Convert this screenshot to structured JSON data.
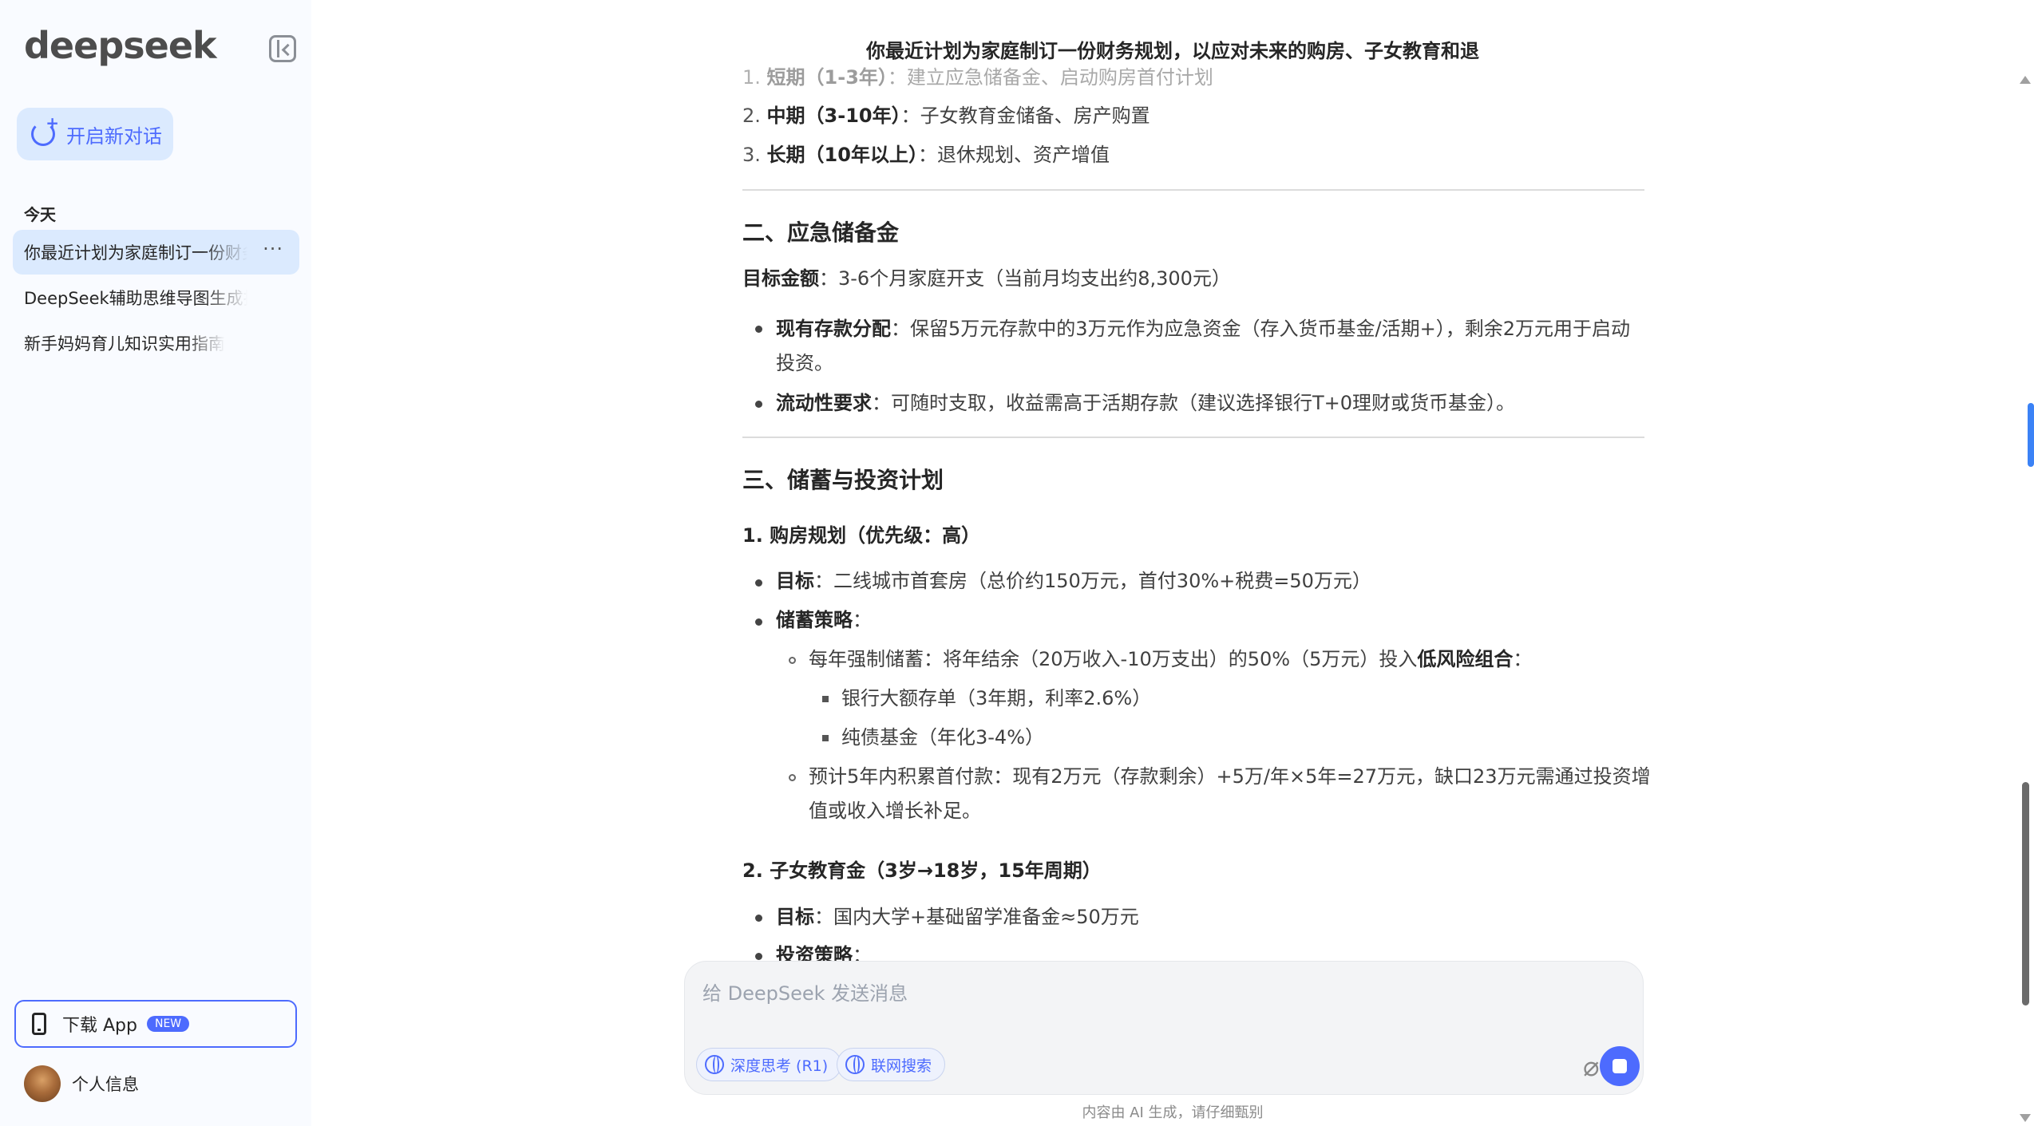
{
  "sidebar": {
    "logo": "deepseek",
    "new_chat_label": "开启新对话",
    "section_today": "今天",
    "conversations": [
      {
        "title": "你最近计划为家庭制订一份财务规划"
      },
      {
        "title": "DeepSeek辅助思维导图生成指南"
      },
      {
        "title": "新手妈妈育儿知识实用指南"
      }
    ],
    "more_label": "···",
    "download_label": "下载 App",
    "download_badge": "NEW",
    "profile_label": "个人信息"
  },
  "chat": {
    "title": "你最近计划为家庭制订一份财务规划，以应对未来的购房、子女教育和退",
    "goals": [
      {
        "num": "1.",
        "bold": "短期（1-3年）",
        "text": "：建立应急储备金、启动购房首付计划"
      },
      {
        "num": "2.",
        "bold": "中期（3-10年）",
        "text": "：子女教育金储备、房产购置"
      },
      {
        "num": "3.",
        "bold": "长期（10年以上）",
        "text": "：退休规划、资产增值"
      }
    ],
    "section2": {
      "heading": "二、应急储备金",
      "target_bold": "目标金额",
      "target_text": "：3-6个月家庭开支（当前月均支出约8,300元）",
      "b1_bold": "现有存款分配",
      "b1_text_line1": "：保留5万元存款中的3万元作为应急资金（存入货币基金/活期+），剩余2万元用于启动",
      "b1_text_line2": "投资。",
      "b2_bold": "流动性要求",
      "b2_text": "：可随时支取，收益需高于活期存款（建议选择银行T+0理财或货币基金）。"
    },
    "section3": {
      "heading": "三、储蓄与投资计划",
      "sub1": "1. 购房规划（优先级：高）",
      "goal_bold": "目标",
      "goal_text": "：二线城市首套房（总价约150万元，首付30%+税费=50万元）",
      "strategy_bold": "储蓄策略",
      "strategy_text": "：",
      "yearly_text": "每年强制储蓄：将年结余（20万收入-10万支出）的50%（5万元）投入",
      "yearly_bold": "低风险组合",
      "yearly_tail": "：",
      "item_a": "银行大额存单（3年期，利率2.6%）",
      "item_b": "纯债基金（年化3-4%）",
      "forecast_line1": "预计5年内积累首付款：现有2万元（存款剩余）+5万/年×5年=27万元，缺口23万元需通过投资增",
      "forecast_line2": "值或收入增长补足。",
      "sub2": "2. 子女教育金（3岁→18岁，15年周期）",
      "edu_goal_bold": "目标",
      "edu_goal_text": "：国内大学+基础留学准备金≈50万元",
      "edu_strategy_bold": "投资策略",
      "edu_strategy_text": "："
    }
  },
  "input": {
    "placeholder": "给 DeepSeek 发送消息",
    "deep_think_label": "深度思考 (R1)",
    "web_search_label": "联网搜索"
  },
  "disclaimer": "内容由 AI 生成，请仔细甄别",
  "colors": {
    "accent": "#4d6bfe",
    "sidebar_bg": "#f9fbff",
    "active_item_bg": "#dbeafe"
  }
}
